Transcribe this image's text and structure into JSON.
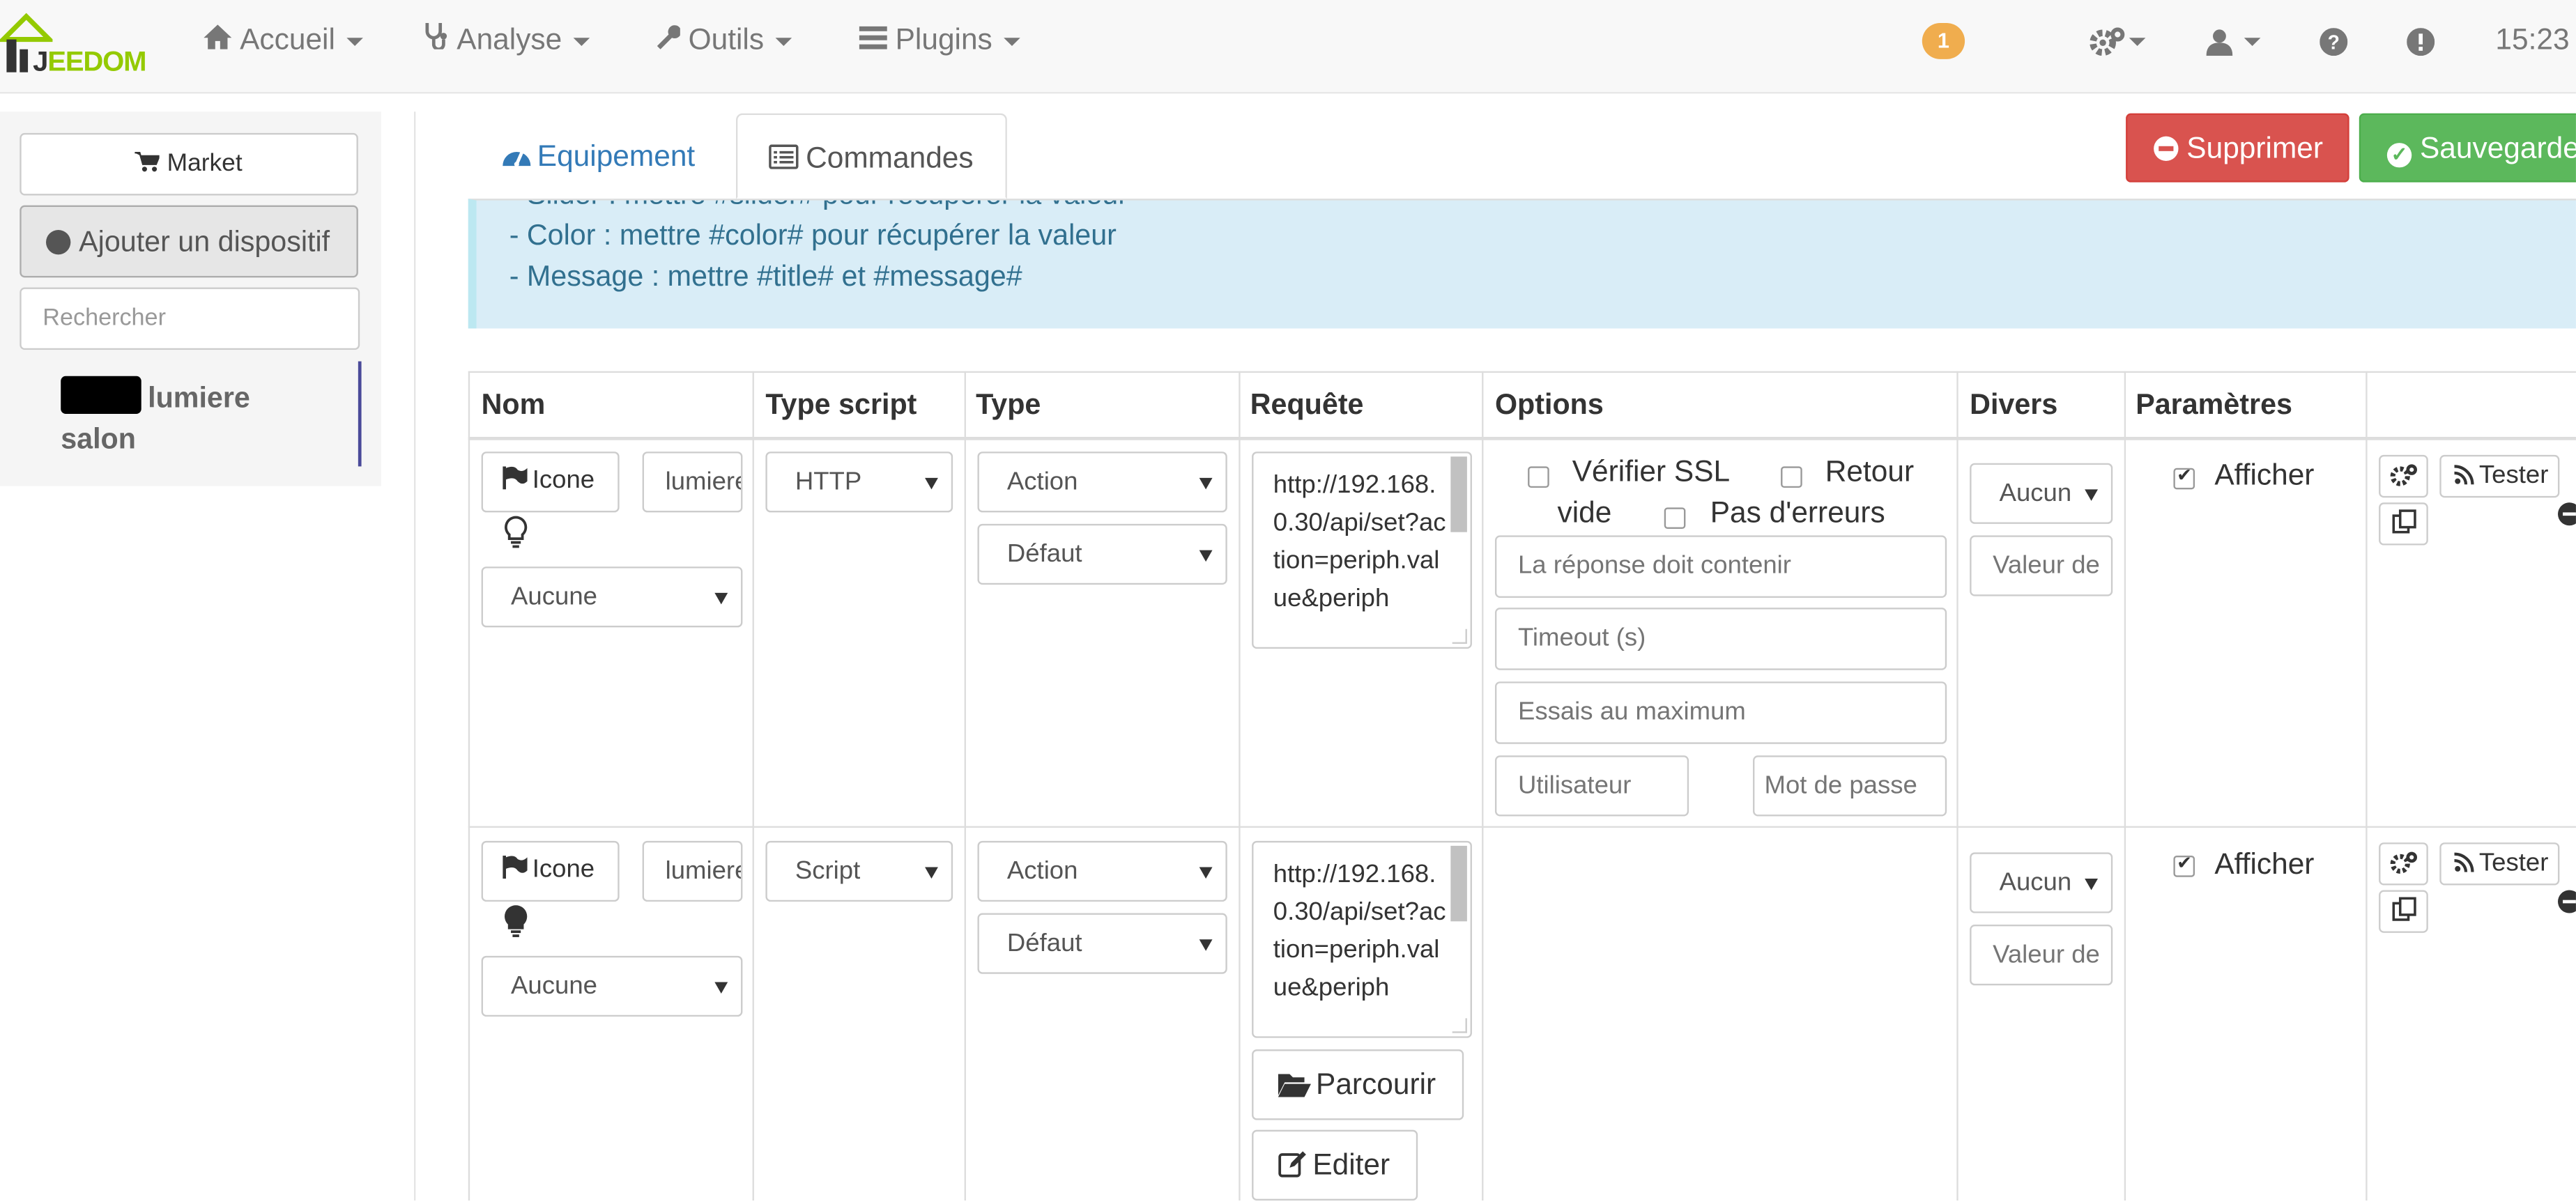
{
  "navbar": {
    "logo_j": "J",
    "logo_rest": "EEDOM",
    "menu": [
      {
        "label": "Accueil",
        "icon": "home-icon"
      },
      {
        "label": "Analyse",
        "icon": "stethoscope-icon"
      },
      {
        "label": "Outils",
        "icon": "wrench-icon"
      },
      {
        "label": "Plugins",
        "icon": "tasks-icon"
      }
    ],
    "notification_count": "1",
    "right_icons": [
      "cogs-icon",
      "user-icon",
      "question-circle-icon",
      "exclamation-circle-icon"
    ],
    "clock": "15:23"
  },
  "sidebar": {
    "market_label": "Market",
    "add_device_label": "Ajouter un dispositif",
    "search_placeholder": "Rechercher",
    "equipment": {
      "name_line1": "lumiere",
      "name_line2": "salon"
    }
  },
  "tabs": {
    "equipment": "Equipement",
    "commands": "Commandes"
  },
  "actions": {
    "delete": "Supprimer",
    "save": "Sauvegarder"
  },
  "info_lines": [
    "- Slider : mettre #slider# pour récupérer la valeur",
    "- Color : mettre #color# pour récupérer la valeur",
    "- Message : mettre #title# et #message#"
  ],
  "table": {
    "headers": [
      "Nom",
      "Type script",
      "Type",
      "Requête",
      "Options",
      "Divers",
      "Paramètres",
      ""
    ],
    "rows": [
      {
        "icon_btn": "Icone",
        "name": "lumiere",
        "bulb": "lightbulb-outline-icon",
        "value_select": "Aucune",
        "script_type": "HTTP",
        "type": "Action",
        "subtype": "Défaut",
        "request": "http://192.168.0.30/api/set?action=periph.value&periph",
        "options": {
          "verify_ssl": "Vérifier SSL",
          "empty_return": "Retour vide",
          "no_errors": "Pas d'erreurs",
          "response_contains_placeholder": "La réponse doit contenir",
          "timeout_placeholder": "Timeout (s)",
          "max_tries_placeholder": "Essais au maximum",
          "user_placeholder": "Utilisateur",
          "password_placeholder": "Mot de passe"
        },
        "divers_select": "Aucun",
        "divers_value_placeholder": "Valeur de",
        "display_label": "Afficher",
        "display_checked": true,
        "test_label": "Tester"
      },
      {
        "icon_btn": "Icone",
        "name": "lumiere",
        "bulb": "lightbulb-icon",
        "value_select": "Aucune",
        "script_type": "Script",
        "type": "Action",
        "subtype": "Défaut",
        "request": "http://192.168.0.30/api/set?action=periph.value&periph",
        "browse_label": "Parcourir",
        "edit_label": "Editer",
        "divers_select": "Aucun",
        "divers_value_placeholder": "Valeur de",
        "display_label": "Afficher",
        "display_checked": true,
        "test_label": "Tester"
      }
    ]
  },
  "colors": {
    "brand_green": "#94ca02",
    "link_blue": "#337ab7",
    "danger": "#d9534f",
    "success": "#5cb85c",
    "info_bg": "#d9edf7",
    "badge": "#f0ad4e"
  }
}
